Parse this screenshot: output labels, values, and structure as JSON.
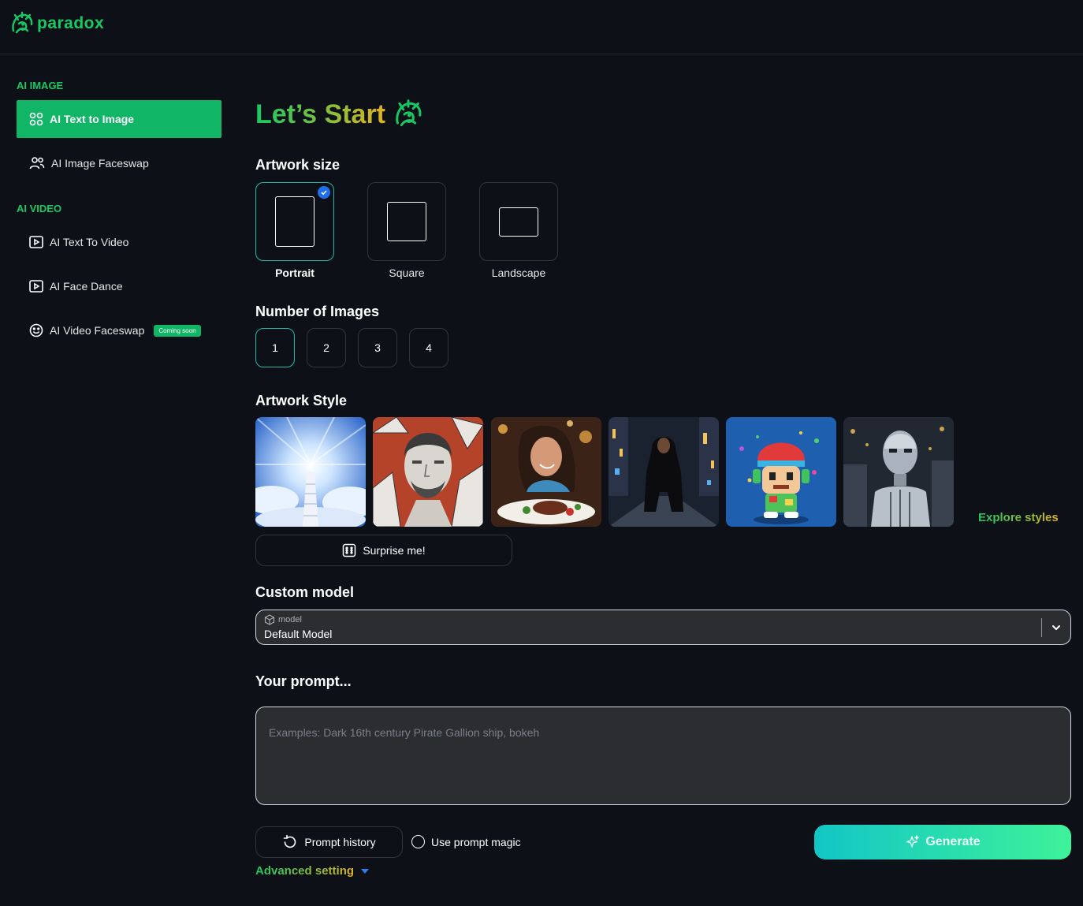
{
  "brand": {
    "name": "paradox",
    "accent": "#17c964"
  },
  "sidebar": {
    "sections": [
      {
        "title": "AI IMAGE"
      },
      {
        "title": "AI VIDEO"
      }
    ],
    "items": [
      {
        "label": "AI Text to Image",
        "icon": "grid-icon",
        "active": true
      },
      {
        "label": "AI Image Faceswap",
        "icon": "users-icon"
      },
      {
        "label": "AI Text To Video",
        "icon": "play-icon"
      },
      {
        "label": "AI Face Dance",
        "icon": "play-icon"
      },
      {
        "label": "AI Video Faceswap",
        "icon": "smile-icon",
        "badge": "Coming soon"
      }
    ]
  },
  "main": {
    "heading": "Let’s Start",
    "artwork_size": {
      "label": "Artwork size",
      "options": [
        {
          "label": "Portrait",
          "selected": true
        },
        {
          "label": "Square"
        },
        {
          "label": "Landscape"
        }
      ]
    },
    "number_of_images": {
      "label": "Number of Images",
      "options": [
        "1",
        "2",
        "3",
        "4"
      ],
      "selected": "1"
    },
    "artwork_style": {
      "label": "Artwork Style",
      "explore_label": "Explore styles",
      "surprise_label": "Surprise me!"
    },
    "custom_model": {
      "label": "Custom model",
      "field_label": "model",
      "value": "Default Model"
    },
    "prompt": {
      "label": "Your prompt...",
      "placeholder": "Examples: Dark 16th century Pirate Gallion ship, bokeh"
    },
    "actions": {
      "history_label": "Prompt history",
      "magic_label": "Use prompt magic",
      "generate_label": "Generate",
      "advanced_label": "Advanced setting"
    }
  }
}
